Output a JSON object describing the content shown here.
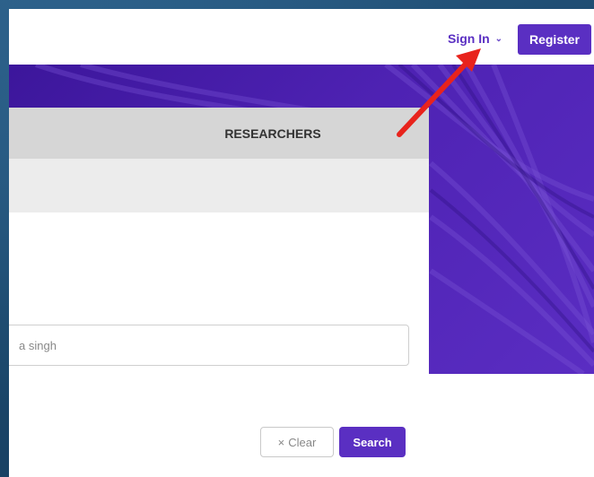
{
  "header": {
    "sign_in_label": "Sign In",
    "register_label": "Register"
  },
  "tabs": {
    "researchers_label": "RESEARCHERS"
  },
  "search": {
    "value": "a singh",
    "clear_label": "Clear",
    "search_label": "Search"
  },
  "colors": {
    "accent": "#5a2fc2",
    "annotation_arrow": "#e8231c"
  },
  "icons": {
    "sign_in_chevron": "chevron-down-icon",
    "clear": "close-icon"
  }
}
